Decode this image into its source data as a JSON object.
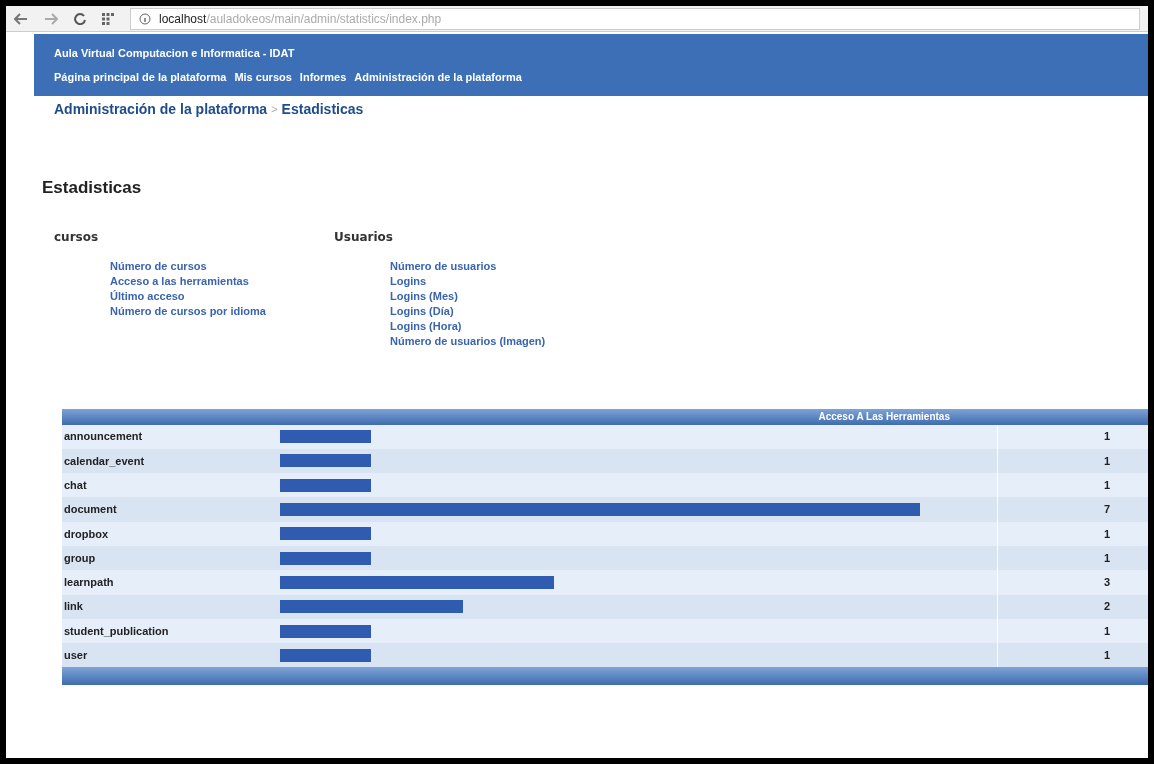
{
  "browser": {
    "url_host": "localhost",
    "url_path": "/auladokeos/main/admin/statistics/index.php"
  },
  "header": {
    "site_title": "Aula Virtual Computacion e Informatica - IDAT",
    "nav": [
      "Página principal de la plataforma",
      "Mis cursos",
      "Informes",
      "Administración de la plataforma"
    ]
  },
  "breadcrumb": [
    "Administración de la plataforma",
    "Estadisticas"
  ],
  "breadcrumb_separator": ">",
  "page_title": "Estadisticas",
  "sections": [
    {
      "title": "cursos",
      "links": [
        "Número de cursos",
        "Acceso a las herramientas",
        "Último acceso",
        "Número de cursos por idioma"
      ]
    },
    {
      "title": "Usuarios",
      "links": [
        "Número de usuarios",
        "Logins",
        "Logins (Mes)",
        "Logins (Día)",
        "Logins (Hora)",
        "Número de usuarios (Imagen)"
      ]
    }
  ],
  "table": {
    "title": "Acceso A Las Herramientas",
    "rows": [
      {
        "name": "announcement",
        "count": "1"
      },
      {
        "name": "calendar_event",
        "count": "1"
      },
      {
        "name": "chat",
        "count": "1"
      },
      {
        "name": "document",
        "count": "7"
      },
      {
        "name": "dropbox",
        "count": "1"
      },
      {
        "name": "group",
        "count": "1"
      },
      {
        "name": "learnpath",
        "count": "3"
      },
      {
        "name": "link",
        "count": "2"
      },
      {
        "name": "student_publication",
        "count": "1"
      },
      {
        "name": "user",
        "count": "1"
      }
    ]
  }
}
